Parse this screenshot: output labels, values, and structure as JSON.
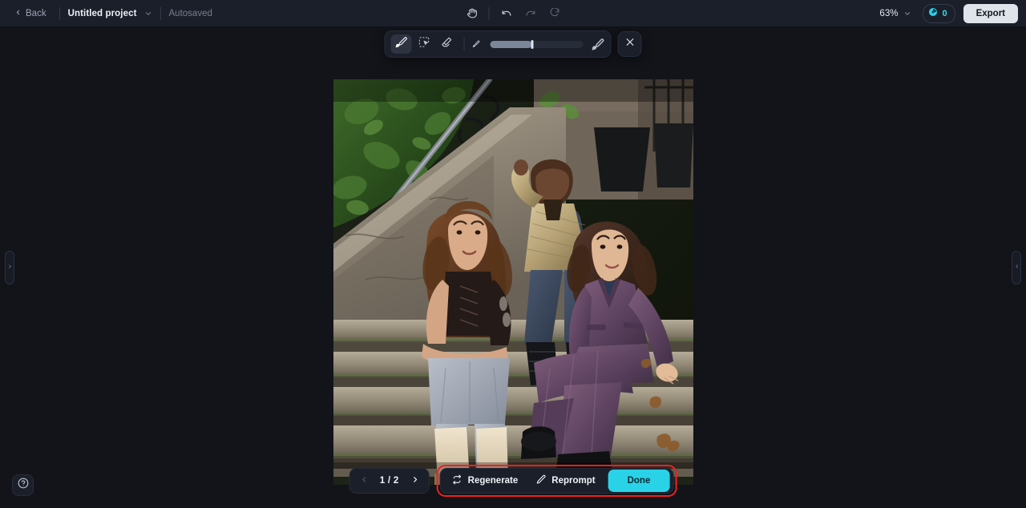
{
  "header": {
    "back_label": "Back",
    "project_name": "Untitled project",
    "autosave_status": "Autosaved",
    "zoom_level": "63%",
    "credits_count": "0",
    "export_label": "Export",
    "accent_cyan": "#2ad2e8",
    "background": "#12141a",
    "surface": "#1b1f29",
    "icons": {
      "back_chevron": "chevron-left-icon",
      "project_dropdown": "chevron-down-icon",
      "pan": "hand-icon",
      "undo": "undo-arrow-icon",
      "redo": "redo-arrow-icon",
      "reset": "refresh-arrow-icon",
      "zoom_dropdown": "chevron-down-icon",
      "credits": "credit-coin-icon"
    }
  },
  "toolbar": {
    "tools": [
      {
        "name": "brush-tool",
        "icon": "brush-icon",
        "active": true
      },
      {
        "name": "smart-select-tool",
        "icon": "magic-select-icon",
        "active": false
      },
      {
        "name": "eraser-tool",
        "icon": "eraser-icon",
        "active": false
      }
    ],
    "brush_size_small_icon": "small-brush-icon",
    "brush_size_large_icon": "large-brush-icon",
    "brush_size_percent": 45,
    "close_icon": "close-x-icon"
  },
  "canvas": {
    "image_alt": "Three women seated on stone stoop steps of a city brownstone",
    "panel_handle_left_icon": "chevron-right-icon",
    "panel_handle_right_icon": "chevron-left-icon",
    "help_icon": "question-mark-circle-icon"
  },
  "bottom_bar": {
    "prev_icon": "chevron-left-icon",
    "next_icon": "chevron-right-icon",
    "page_label": "1 / 2",
    "regenerate_label": "Regenerate",
    "regenerate_icon": "refresh-swap-icon",
    "reprompt_label": "Reprompt",
    "reprompt_icon": "pencil-icon",
    "done_label": "Done",
    "highlight_color": "#f21f1f"
  }
}
